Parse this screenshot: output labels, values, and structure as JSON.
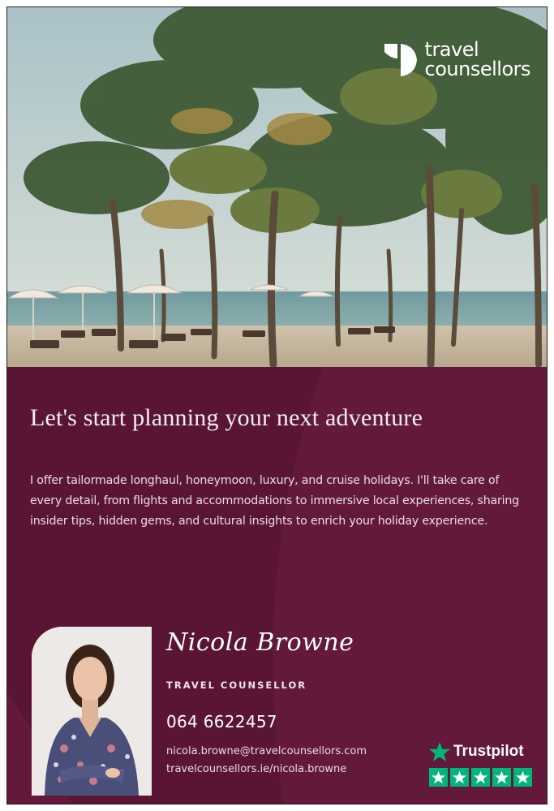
{
  "brand": {
    "line1": "travel",
    "line2": "counsellors",
    "logo_icon": "travel-counsellors-mark-icon"
  },
  "headline": "Let's start planning your next adventure",
  "intro": "I offer tailormade longhaul, honeymoon, luxury, and cruise holidays. I'll take care of every detail, from flights and accommodations to immersive local experiences, sharing insider tips, hidden gems, and cultural insights to enrich your holiday experience.",
  "counsellor": {
    "signature": "Nicola Browne",
    "role": "TRAVEL COUNSELLOR",
    "phone": "064 6622457",
    "email": "nicola.browne@travelcounsellors.com",
    "website": "travelcounsellors.ie/nicola.browne"
  },
  "trustpilot": {
    "name": "Trustpilot",
    "stars": 5,
    "star_icon": "trustpilot-star-icon"
  },
  "colors": {
    "panel": "#5a1535",
    "trustpilot_green": "#00b67a",
    "text_light": "#eadde4"
  }
}
